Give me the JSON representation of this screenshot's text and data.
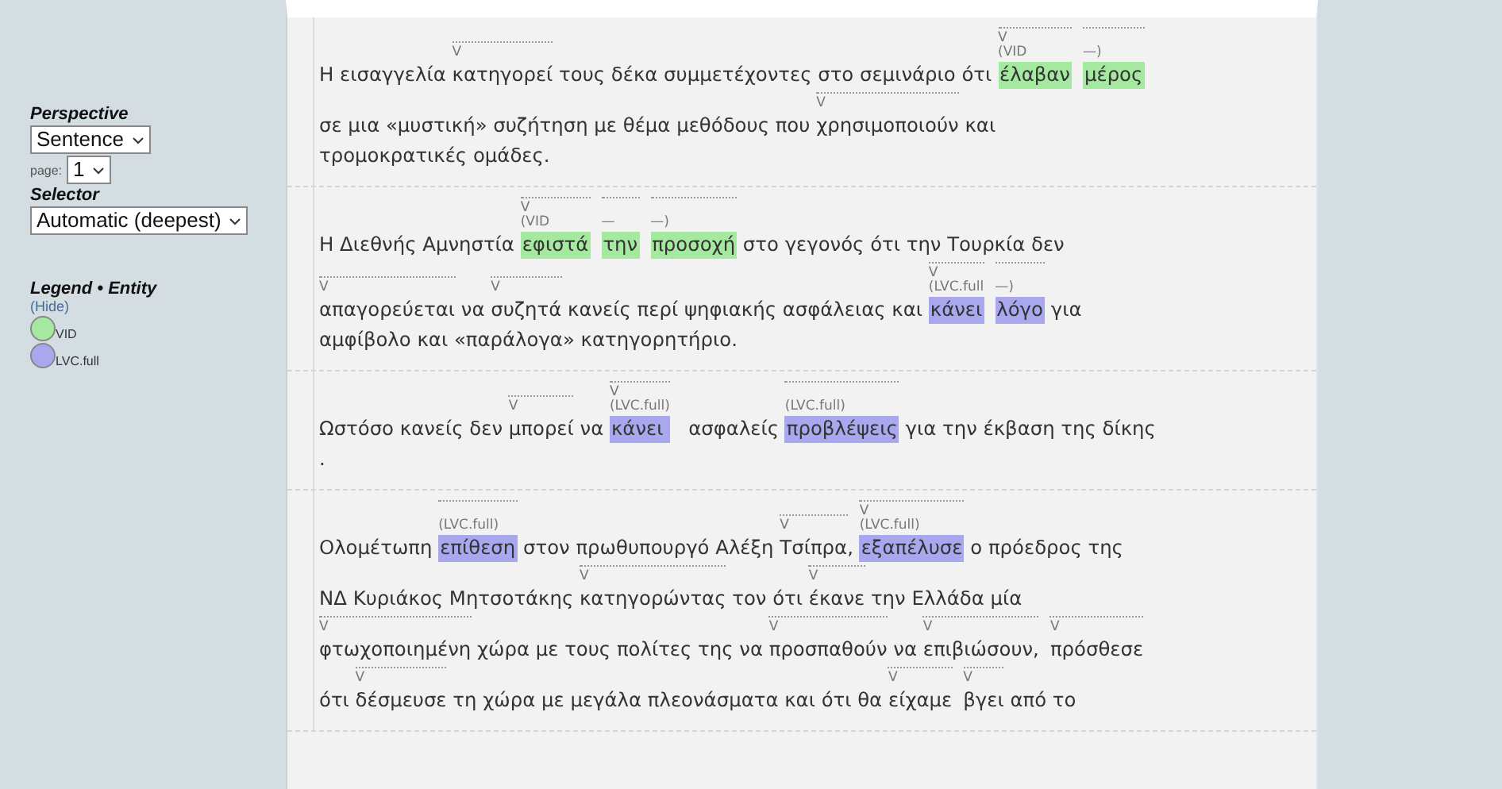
{
  "sidebar": {
    "perspective": {
      "label": "Perspective",
      "value": "Sentence"
    },
    "page": {
      "label": "page:",
      "value": "1"
    },
    "selector": {
      "label": "Selector",
      "value": "Automatic (deepest)"
    },
    "legend": {
      "title": "Legend • Entity",
      "hide_link": "(Hide)",
      "items": [
        {
          "label": "VID",
          "color": "#a5e8a0"
        },
        {
          "label": "LVC.full",
          "color": "#a9a8ee"
        }
      ]
    }
  },
  "sentences": [
    {
      "lines": [
        [
          {
            "text": "Η εισαγγελία "
          },
          {
            "text": "κατηγορεί",
            "tag": "V"
          },
          {
            "text": " τους δέκα συμμετέχοντες στο σεμινάριο ότι "
          },
          {
            "text": "έλαβαν",
            "tag": "V",
            "label": "(VID",
            "color": "#a5e8a0"
          },
          {
            "text": "μέρος",
            "label": "—)",
            "color": "#a5e8a0"
          }
        ],
        [
          {
            "text": "σε μια «μυστική» συζήτηση με θέμα μεθόδους που "
          },
          {
            "text": "χρησιμοποιούν",
            "tag": "V"
          },
          {
            "text": " και"
          }
        ],
        [
          {
            "text": "τρομοκρατικές ομάδες."
          }
        ]
      ]
    },
    {
      "lines": [
        [
          {
            "text": "Η Διεθνής Αμνηστία "
          },
          {
            "text": "εφιστά",
            "tag": "V",
            "label": "(VID",
            "color": "#a5e8a0"
          },
          {
            "text": "την",
            "label": "—",
            "color": "#a5e8a0"
          },
          {
            "text": "προσοχή",
            "label": "—)",
            "color": "#a5e8a0"
          },
          {
            "text": " στο γεγονός ότι την Τουρκία δεν"
          }
        ],
        [
          {
            "text": "απαγορεύεται",
            "tag": "V"
          },
          {
            "text": " να "
          },
          {
            "text": "συζητά",
            "tag": "V"
          },
          {
            "text": " κανείς περί ψηφιακής ασφάλειας και "
          },
          {
            "text": "κάνει",
            "tag": "V",
            "label": "(LVC.full",
            "color": "#a9a8ee"
          },
          {
            "text": "λόγο",
            "label": "—)",
            "color": "#a9a8ee"
          },
          {
            "text": " για"
          }
        ],
        [
          {
            "text": "αμφίβολο και «παράλογα» κατηγορητήριο."
          }
        ]
      ]
    },
    {
      "lines": [
        [
          {
            "text": "Ωστόσο κανείς δεν "
          },
          {
            "text": "μπορεί",
            "tag": "V"
          },
          {
            "text": " να "
          },
          {
            "text": "κάνει",
            "tag": "V",
            "label": "(LVC.full)",
            "color": "#a9a8ee"
          },
          {
            "text": "   ασφαλείς "
          },
          {
            "text": "προβλέψεις",
            "label": "(LVC.full)",
            "color": "#a9a8ee"
          },
          {
            "text": " για την έκβαση της δίκης"
          }
        ],
        [
          {
            "text": "."
          }
        ]
      ]
    },
    {
      "lines": [
        [
          {
            "text": "Ολομέτωπη "
          },
          {
            "text": "επίθεση",
            "label": "(LVC.full)",
            "color": "#a9a8ee"
          },
          {
            "text": " στον πρωθυπουργό Αλέξη "
          },
          {
            "text": "Τσίπρα",
            "tag": "V"
          },
          {
            "text": ", "
          },
          {
            "text": "εξαπέλυσε",
            "tag": "V",
            "label": "(LVC.full)",
            "color": "#a9a8ee"
          },
          {
            "text": " ο πρόεδρος της"
          }
        ],
        [
          {
            "text": "ΝΔ Κυριάκος Μητσοτάκης "
          },
          {
            "text": "κατηγορώντας",
            "tag": "V"
          },
          {
            "text": " τον ότι "
          },
          {
            "text": "έκανε",
            "tag": "V"
          },
          {
            "text": " την Ελλάδα μία"
          }
        ],
        [
          {
            "text": "φτωχοποιημένη",
            "tag": "V"
          },
          {
            "text": " χώρα με τους πολίτες της να "
          },
          {
            "text": "προσπαθούν",
            "tag": "V"
          },
          {
            "text": " να "
          },
          {
            "text": "επιβιώσουν,",
            "tag": "V"
          },
          {
            "text": "πρόσθεσε",
            "tag": "V"
          }
        ],
        [
          {
            "text": "ότι "
          },
          {
            "text": "δέσμευσε",
            "tag": "V"
          },
          {
            "text": " τη χώρα με μεγάλα πλεονάσματα και ότι θα "
          },
          {
            "text": "είχαμε",
            "tag": "V"
          },
          {
            "text": "βγει",
            "tag": "V"
          },
          {
            "text": " από το"
          }
        ]
      ]
    }
  ]
}
